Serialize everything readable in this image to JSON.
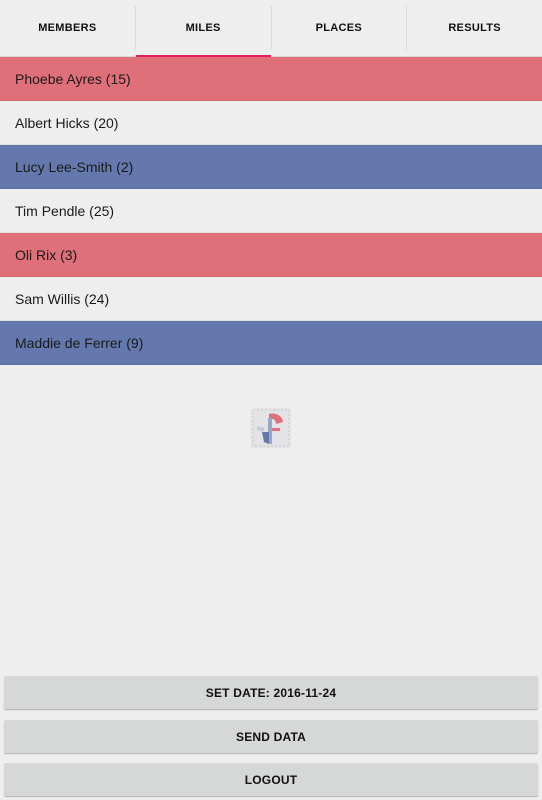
{
  "tabs": [
    {
      "label": "MEMBERS",
      "active": false
    },
    {
      "label": "MILES",
      "active": true
    },
    {
      "label": "PLACES",
      "active": false
    },
    {
      "label": "RESULTS",
      "active": false
    }
  ],
  "accent_color": "#e91e63",
  "row_colors": {
    "red": "#df6f79",
    "blue": "#6478ad",
    "none": "#eeeeee"
  },
  "members": [
    {
      "label": "Phoebe Ayres (15)",
      "color": "red"
    },
    {
      "label": "Albert Hicks (20)",
      "color": "none"
    },
    {
      "label": "Lucy Lee-Smith (2)",
      "color": "blue"
    },
    {
      "label": "Tim Pendle (25)",
      "color": "none"
    },
    {
      "label": "Oli Rix (3)",
      "color": "red"
    },
    {
      "label": "Sam Willis (24)",
      "color": "none"
    },
    {
      "label": "Maddie de Ferrer (9)",
      "color": "blue"
    }
  ],
  "logo": {
    "icon": "club-logo-icon"
  },
  "buttons": {
    "set_date": "SET DATE: 2016-11-24",
    "send_data": "SEND DATA",
    "logout": "LOGOUT"
  }
}
